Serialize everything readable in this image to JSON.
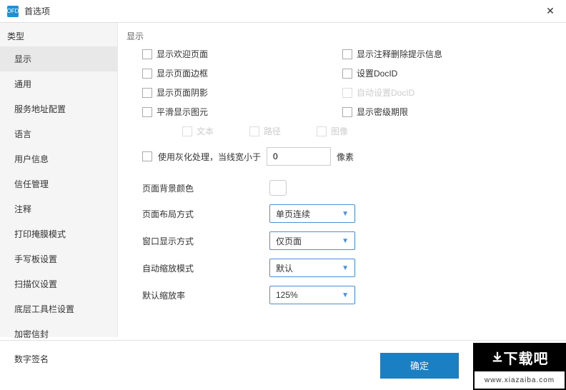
{
  "window": {
    "icon_text": "OFD",
    "title": "首选项"
  },
  "sidebar": {
    "header": "类型",
    "items": [
      {
        "label": "显示",
        "active": true
      },
      {
        "label": "通用"
      },
      {
        "label": "服务地址配置"
      },
      {
        "label": "语言"
      },
      {
        "label": "用户信息"
      },
      {
        "label": "信任管理"
      },
      {
        "label": "注释"
      },
      {
        "label": "打印掩膜模式"
      },
      {
        "label": "手写板设置"
      },
      {
        "label": "扫描仪设置"
      },
      {
        "label": "底层工具栏设置"
      },
      {
        "label": "加密信封"
      },
      {
        "label": "数字签名"
      }
    ]
  },
  "content": {
    "group_label": "显示",
    "checks_left": [
      "显示欢迎页面",
      "显示页面边框",
      "显示页面阴影",
      "平滑显示图元"
    ],
    "checks_right": [
      {
        "label": "显示注释删除提示信息"
      },
      {
        "label": "设置DocID"
      },
      {
        "label": "自动设置DocID",
        "disabled": true
      },
      {
        "label": "显示密级期限"
      }
    ],
    "subchecks": [
      "文本",
      "路径",
      "图像"
    ],
    "gray_row": {
      "label": "使用灰化处理，当线宽小于",
      "value": "0",
      "unit": "像素"
    },
    "bgcolor_label": "页面背景颜色",
    "selects": [
      {
        "label": "页面布局方式",
        "value": "单页连续"
      },
      {
        "label": "窗口显示方式",
        "value": "仅页面"
      },
      {
        "label": "自动缩放模式",
        "value": "默认"
      },
      {
        "label": "默认缩放率",
        "value": "125%"
      }
    ]
  },
  "footer": {
    "ok": "确定"
  },
  "watermark": {
    "top": "下载吧",
    "bottom": "www.xiazaiba.com"
  }
}
